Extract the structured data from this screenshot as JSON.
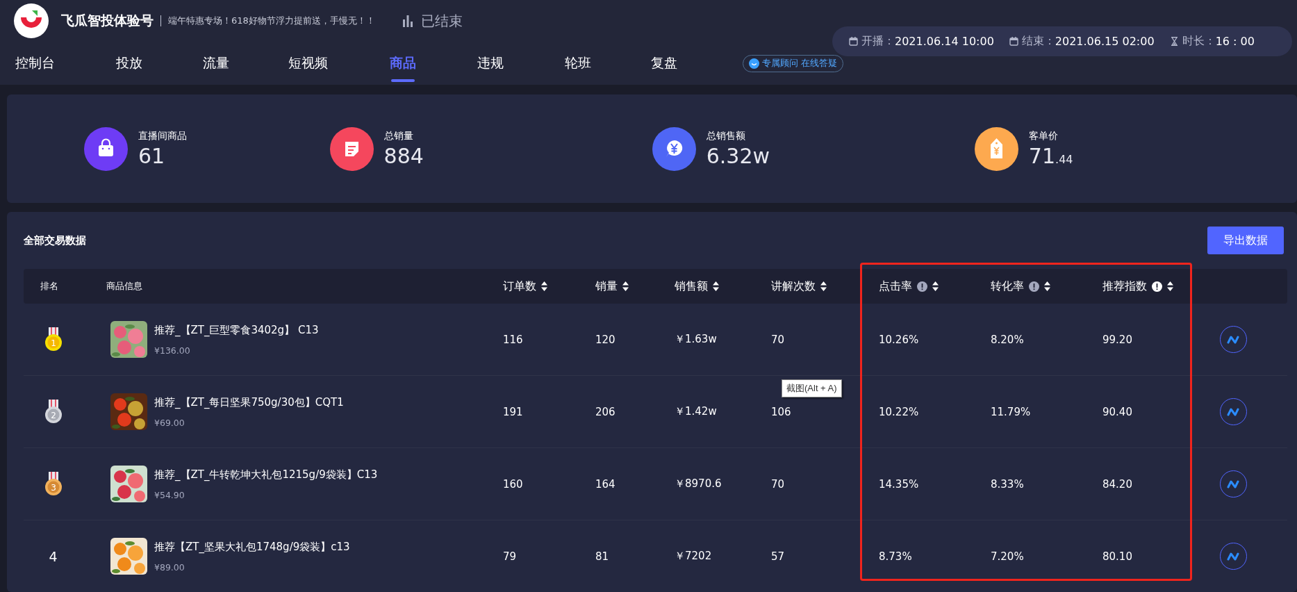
{
  "header": {
    "brand": "飞瓜智投体验号",
    "slogan": "端午特惠专场！618好物节浮力提前送，手慢无！！",
    "status": "已结束"
  },
  "tabs": [
    {
      "label": "控制台",
      "selected": false
    },
    {
      "label": "投放",
      "selected": false
    },
    {
      "label": "流量",
      "selected": false
    },
    {
      "label": "短视频",
      "selected": false
    },
    {
      "label": "商品",
      "selected": true
    },
    {
      "label": "违规",
      "selected": false
    },
    {
      "label": "轮班",
      "selected": false
    },
    {
      "label": "复盘",
      "selected": false
    }
  ],
  "consult_badge": "专属顾问 在线答疑",
  "schedule": [
    {
      "kind": "calendar",
      "label": "开播：",
      "value": "2021.06.14 10:00"
    },
    {
      "kind": "calendar",
      "label": "结束：",
      "value": "2021.06.15 02:00"
    },
    {
      "kind": "hourglass",
      "label": "时长：",
      "value": "16 : 00"
    }
  ],
  "stats": [
    {
      "kind": "bag",
      "color": "#6e3cf5",
      "label": "直播间商品",
      "value": "61"
    },
    {
      "kind": "note",
      "color": "#f5475d",
      "label": "总销量",
      "value": "884"
    },
    {
      "kind": "yen",
      "color": "#4f66f5",
      "label": "总销售额",
      "value": "6.32w"
    },
    {
      "kind": "tag",
      "color": "#fda94f",
      "label": "客单价",
      "value": "71",
      "value_decimal": ".44"
    }
  ],
  "table": {
    "title": "全部交易数据",
    "export_button": "导出数据",
    "columns": [
      {
        "label": "排名",
        "sortable": false,
        "info": false
      },
      {
        "label": "商品信息",
        "sortable": false,
        "info": false
      },
      {
        "label": "订单数",
        "sortable": true,
        "info": false
      },
      {
        "label": "销量",
        "sortable": true,
        "info": false
      },
      {
        "label": "销售额",
        "sortable": true,
        "info": false
      },
      {
        "label": "讲解次数",
        "sortable": true,
        "info": false
      },
      {
        "label": "点击率",
        "sortable": true,
        "info": true,
        "info_active": false
      },
      {
        "label": "转化率",
        "sortable": true,
        "info": true,
        "info_active": false
      },
      {
        "label": "推荐指数",
        "sortable": true,
        "info": true,
        "info_active": true
      }
    ],
    "rows": [
      {
        "cells": [
          {
            "kind": "gold",
            "text": "1"
          },
          {
            "kind": "product",
            "name": "推荐_【ZT_巨型零食3402g】 C13",
            "price": "¥136.00"
          },
          {
            "kind": "text",
            "text": "116"
          },
          {
            "kind": "text",
            "text": "120"
          },
          {
            "kind": "text",
            "text": "￥1.63w"
          },
          {
            "kind": "text",
            "text": "70"
          },
          {
            "kind": "text",
            "text": "10.26%"
          },
          {
            "kind": "text",
            "text": "8.20%"
          },
          {
            "kind": "text",
            "text": "99.20"
          }
        ]
      },
      {
        "cells": [
          {
            "kind": "silver",
            "text": "2"
          },
          {
            "kind": "product",
            "name": "推荐_【ZT_每日坚果750g/30包】CQT1",
            "price": "¥69.00"
          },
          {
            "kind": "text",
            "text": "191"
          },
          {
            "kind": "text",
            "text": "206"
          },
          {
            "kind": "text",
            "text": "￥1.42w"
          },
          {
            "kind": "text",
            "text": "106"
          },
          {
            "kind": "text",
            "text": "10.22%"
          },
          {
            "kind": "text",
            "text": "11.79%"
          },
          {
            "kind": "text",
            "text": "90.40"
          }
        ]
      },
      {
        "cells": [
          {
            "kind": "bronze",
            "text": "3"
          },
          {
            "kind": "product",
            "name": "推荐_【ZT_牛转乾坤大礼包1215g/9袋装】C13",
            "price": "¥54.90"
          },
          {
            "kind": "text",
            "text": "160"
          },
          {
            "kind": "text",
            "text": "164"
          },
          {
            "kind": "text",
            "text": "￥8970.6"
          },
          {
            "kind": "text",
            "text": "70"
          },
          {
            "kind": "text",
            "text": "14.35%"
          },
          {
            "kind": "text",
            "text": "8.33%"
          },
          {
            "kind": "text",
            "text": "84.20"
          }
        ]
      },
      {
        "cells": [
          {
            "kind": "number",
            "text": "4"
          },
          {
            "kind": "product",
            "name": "推荐【ZT_坚果大礼包1748g/9袋装】c13",
            "price": "¥89.00"
          },
          {
            "kind": "text",
            "text": "79"
          },
          {
            "kind": "text",
            "text": "81"
          },
          {
            "kind": "text",
            "text": "￥7202"
          },
          {
            "kind": "text",
            "text": "57"
          },
          {
            "kind": "text",
            "text": "8.73%"
          },
          {
            "kind": "text",
            "text": "7.20%"
          },
          {
            "kind": "text",
            "text": "80.10"
          }
        ]
      }
    ]
  },
  "tooltip": "截图(Alt + A)"
}
